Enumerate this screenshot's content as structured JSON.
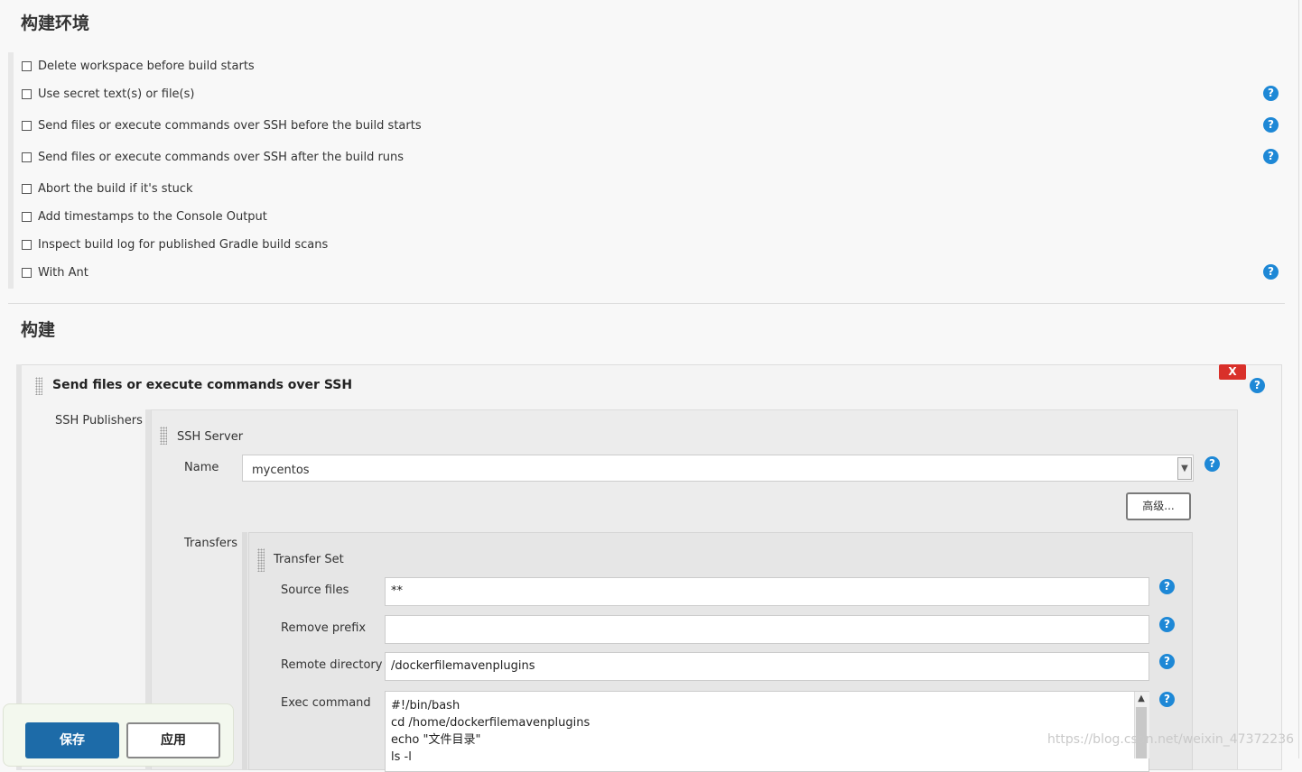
{
  "build_env": {
    "title": "构建环境",
    "options": [
      {
        "label": "Delete workspace before build starts",
        "checked": false,
        "help": false
      },
      {
        "label": "Use secret text(s) or file(s)",
        "checked": false,
        "help": true
      },
      {
        "label": "Send files or execute commands over SSH before the build starts",
        "checked": false,
        "help": true
      },
      {
        "label": "Send files or execute commands over SSH after the build runs",
        "checked": false,
        "help": true
      },
      {
        "label": "Abort the build if it's stuck",
        "checked": false,
        "help": false
      },
      {
        "label": "Add timestamps to the Console Output",
        "checked": false,
        "help": false
      },
      {
        "label": "Inspect build log for published Gradle build scans",
        "checked": false,
        "help": false
      },
      {
        "label": "With Ant",
        "checked": false,
        "help": true
      }
    ]
  },
  "build": {
    "title": "构建",
    "step": {
      "title": "Send files or execute commands over SSH",
      "delete_label": "X",
      "publishers_label": "SSH Publishers",
      "server": {
        "title": "SSH Server",
        "name_label": "Name",
        "name_value": "mycentos",
        "advanced_label": "高级..."
      },
      "transfers": {
        "label": "Transfers",
        "set_title": "Transfer Set",
        "source_files_label": "Source files",
        "source_files_value": "**",
        "remove_prefix_label": "Remove prefix",
        "remove_prefix_value": "",
        "remote_directory_label": "Remote directory",
        "remote_directory_value": "/dockerfilemavenplugins",
        "exec_command_label": "Exec command",
        "exec_command_lines": [
          "#!/bin/bash",
          "cd /home/dockerfilemavenplugins",
          "echo \"文件目录\"",
          "ls -l"
        ]
      }
    }
  },
  "help_glyph": "?",
  "actions": {
    "save_label": "保存",
    "apply_label": "应用"
  },
  "watermark": "https://blog.csdn.net/weixin_47372236",
  "colors": {
    "help": "#1e88d6",
    "save": "#1d6ba8",
    "delete": "#d9302a"
  },
  "icons": {
    "help": "help-icon",
    "dropdown": "chevron-down-icon",
    "grip": "drag-handle-icon"
  }
}
